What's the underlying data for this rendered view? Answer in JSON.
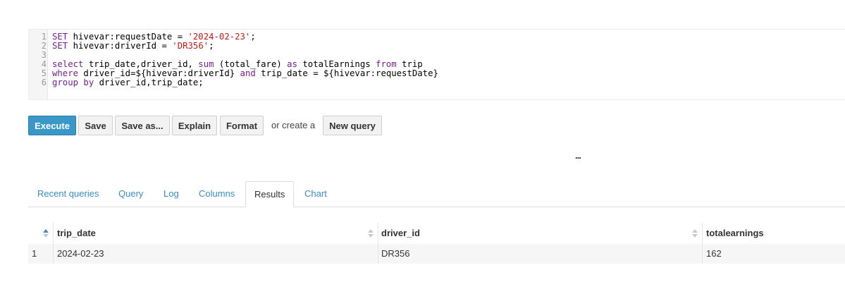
{
  "editor": {
    "line_numbers": [
      "1",
      "2",
      "3",
      "4",
      "5",
      "6"
    ],
    "lines": [
      [
        {
          "t": "SET",
          "c": "kw"
        },
        {
          "t": " hivevar:requestDate = ",
          "c": ""
        },
        {
          "t": "'2024-02-23'",
          "c": "str"
        },
        {
          "t": ";",
          "c": ""
        }
      ],
      [
        {
          "t": "SET",
          "c": "kw"
        },
        {
          "t": " hivevar:driverId = ",
          "c": ""
        },
        {
          "t": "'DR356'",
          "c": "str"
        },
        {
          "t": ";",
          "c": ""
        }
      ],
      [],
      [
        {
          "t": "select",
          "c": "kw"
        },
        {
          "t": " trip_date,driver_id, ",
          "c": ""
        },
        {
          "t": "sum",
          "c": "kw"
        },
        {
          "t": " (total_fare) ",
          "c": ""
        },
        {
          "t": "as",
          "c": "kw"
        },
        {
          "t": " totalEarnings ",
          "c": ""
        },
        {
          "t": "from",
          "c": "kw"
        },
        {
          "t": " trip",
          "c": ""
        }
      ],
      [
        {
          "t": "where",
          "c": "kw"
        },
        {
          "t": " driver_id=${hivevar:driverId} ",
          "c": ""
        },
        {
          "t": "and",
          "c": "kw"
        },
        {
          "t": " trip_date = ${hivevar:requestDate}",
          "c": ""
        }
      ],
      [
        {
          "t": "group by",
          "c": "kw"
        },
        {
          "t": " driver_id,trip_date;",
          "c": ""
        }
      ]
    ]
  },
  "toolbar": {
    "execute_label": "Execute",
    "save_label": "Save",
    "save_as_label": "Save as...",
    "explain_label": "Explain",
    "format_label": "Format",
    "or_create_text": "or create a",
    "new_query_label": "New query"
  },
  "resize_handle": "...",
  "tabs": {
    "recent": "Recent queries",
    "query": "Query",
    "log": "Log",
    "columns": "Columns",
    "results": "Results",
    "chart": "Chart",
    "active": "Results"
  },
  "results": {
    "columns": [
      "trip_date",
      "driver_id",
      "totalearnings"
    ],
    "rows": [
      {
        "index": "1",
        "cells": [
          "2024-02-23",
          "DR356",
          "162"
        ]
      }
    ]
  },
  "colors": {
    "primary_button": "#3a98c9",
    "link": "#3a8dc9",
    "keyword": "#7a1f91",
    "string": "#c41a16"
  }
}
